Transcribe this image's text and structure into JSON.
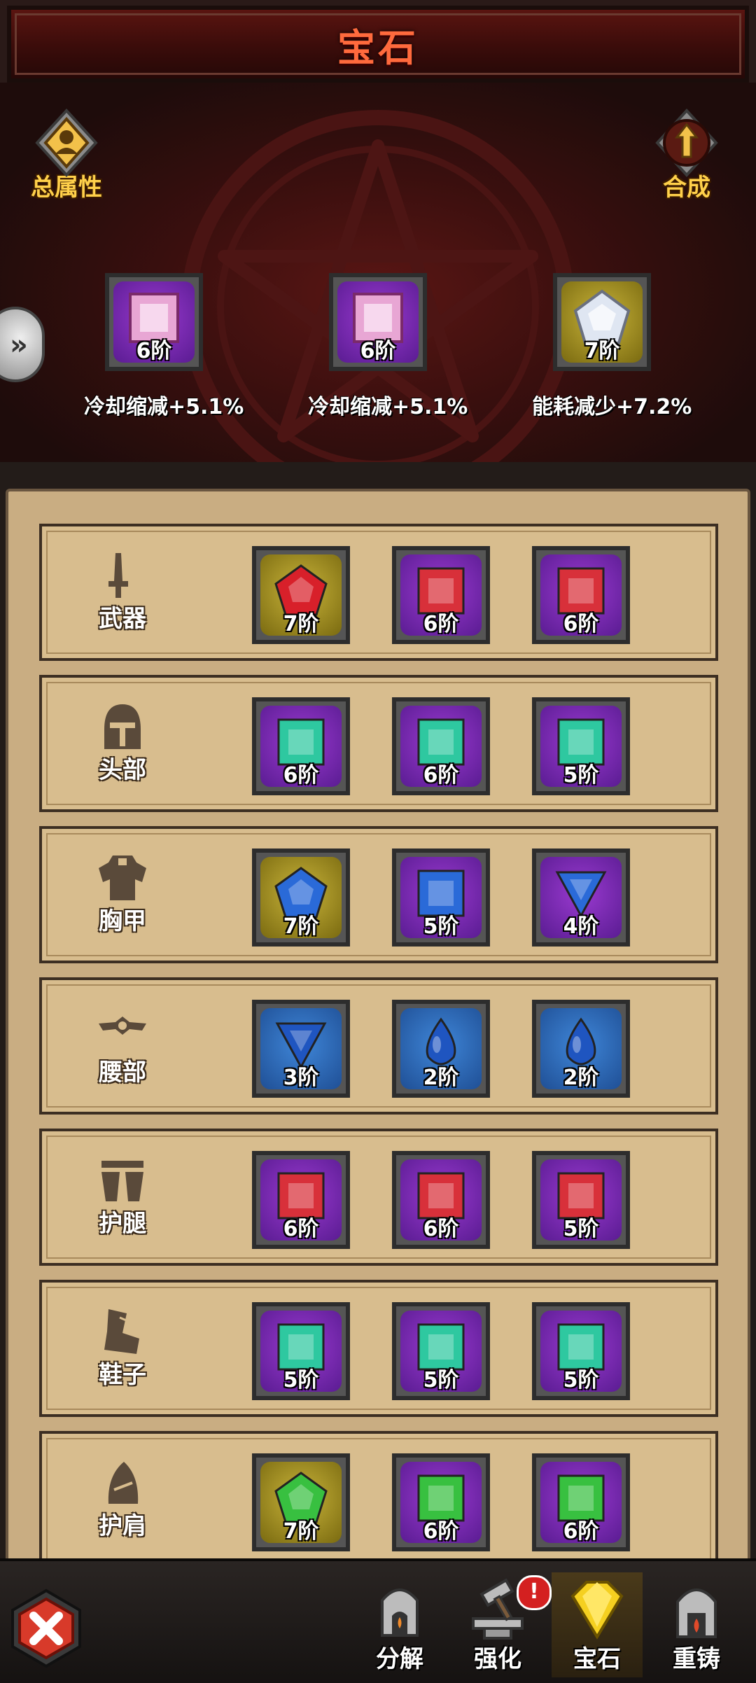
{
  "header": {
    "title": "宝石"
  },
  "top_buttons": {
    "attributes_label": "总属性",
    "synthesize_label": "合成"
  },
  "featured": [
    {
      "tier": "6阶",
      "bonus": "冷却缩减+5.1%",
      "frame": "purple",
      "gem": "pink-square"
    },
    {
      "tier": "6阶",
      "bonus": "冷却缩减+5.1%",
      "frame": "purple",
      "gem": "pink-square"
    },
    {
      "tier": "7阶",
      "bonus": "能耗减少+7.2%",
      "frame": "gold",
      "gem": "white-pentagon"
    }
  ],
  "slots": [
    {
      "label": "武器",
      "icon": "sword-icon",
      "gems": [
        {
          "tier": "7阶",
          "frame": "gold",
          "color": "#d8202a",
          "shape": "pentagon"
        },
        {
          "tier": "6阶",
          "frame": "purple",
          "color": "#d8303a",
          "shape": "square"
        },
        {
          "tier": "6阶",
          "frame": "purple",
          "color": "#d8303a",
          "shape": "square"
        }
      ]
    },
    {
      "label": "头部",
      "icon": "helmet-icon",
      "gems": [
        {
          "tier": "6阶",
          "frame": "purple",
          "color": "#2ec8a0",
          "shape": "square"
        },
        {
          "tier": "6阶",
          "frame": "purple",
          "color": "#2ec8a0",
          "shape": "square"
        },
        {
          "tier": "5阶",
          "frame": "purple",
          "color": "#2ec8a0",
          "shape": "square"
        }
      ]
    },
    {
      "label": "胸甲",
      "icon": "chest-armor-icon",
      "gems": [
        {
          "tier": "7阶",
          "frame": "gold",
          "color": "#2a6ad8",
          "shape": "pentagon"
        },
        {
          "tier": "5阶",
          "frame": "purple",
          "color": "#2a6ad8",
          "shape": "square"
        },
        {
          "tier": "4阶",
          "frame": "purple",
          "color": "#2a6ad8",
          "shape": "triangle"
        }
      ]
    },
    {
      "label": "腰部",
      "icon": "belt-icon",
      "gems": [
        {
          "tier": "3阶",
          "frame": "blue",
          "color": "#1f55c0",
          "shape": "triangle"
        },
        {
          "tier": "2阶",
          "frame": "blue",
          "color": "#1f55c0",
          "shape": "drop"
        },
        {
          "tier": "2阶",
          "frame": "blue",
          "color": "#1f55c0",
          "shape": "drop"
        }
      ]
    },
    {
      "label": "护腿",
      "icon": "leg-armor-icon",
      "gems": [
        {
          "tier": "6阶",
          "frame": "purple",
          "color": "#d8303a",
          "shape": "square"
        },
        {
          "tier": "6阶",
          "frame": "purple",
          "color": "#d8303a",
          "shape": "square"
        },
        {
          "tier": "5阶",
          "frame": "purple",
          "color": "#d8303a",
          "shape": "square"
        }
      ]
    },
    {
      "label": "鞋子",
      "icon": "boots-icon",
      "gems": [
        {
          "tier": "5阶",
          "frame": "purple",
          "color": "#2ec8a0",
          "shape": "square"
        },
        {
          "tier": "5阶",
          "frame": "purple",
          "color": "#2ec8a0",
          "shape": "square"
        },
        {
          "tier": "5阶",
          "frame": "purple",
          "color": "#2ec8a0",
          "shape": "square"
        }
      ]
    },
    {
      "label": "护肩",
      "icon": "shoulder-armor-icon",
      "gems": [
        {
          "tier": "7阶",
          "frame": "gold",
          "color": "#38c040",
          "shape": "pentagon"
        },
        {
          "tier": "6阶",
          "frame": "purple",
          "color": "#38c040",
          "shape": "square"
        },
        {
          "tier": "6阶",
          "frame": "purple",
          "color": "#38c040",
          "shape": "square"
        }
      ]
    }
  ],
  "tabs": [
    {
      "label": "分解",
      "icon": "furnace-icon",
      "active": false
    },
    {
      "label": "强化",
      "icon": "hammer-anvil-icon",
      "active": false,
      "alert": "!"
    },
    {
      "label": "宝石",
      "icon": "gem-icon",
      "active": true
    },
    {
      "label": "重铸",
      "icon": "forge-icon",
      "active": false
    }
  ]
}
